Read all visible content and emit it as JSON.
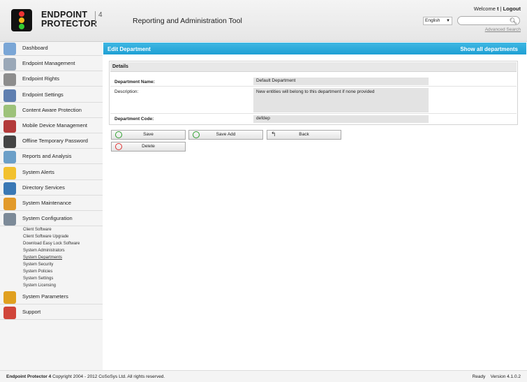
{
  "header": {
    "brand_line1": "ENDPOINT",
    "brand_line2": "PROTECTOR",
    "brand_version": "4",
    "tool_title": "Reporting and Administration Tool",
    "welcome_prefix": "Welcome ",
    "welcome_user": "t",
    "welcome_sep": " | ",
    "logout_label": "Logout",
    "language_value": "English",
    "search_placeholder": "",
    "advanced_search_label": "Advanced Search"
  },
  "sidebar": {
    "items": [
      {
        "label": "Dashboard",
        "icon": "dashboard-icon",
        "color": "#7aa6d6"
      },
      {
        "label": "Endpoint Management",
        "icon": "endpoint-management-icon",
        "color": "#9aa8b8"
      },
      {
        "label": "Endpoint Rights",
        "icon": "endpoint-rights-icon",
        "color": "#8d8d8d"
      },
      {
        "label": "Endpoint Settings",
        "icon": "endpoint-settings-icon",
        "color": "#5f7fb0"
      },
      {
        "label": "Content Aware Protection",
        "icon": "content-aware-icon",
        "color": "#9dc27a"
      },
      {
        "label": "Mobile Device Management",
        "icon": "mobile-device-icon",
        "color": "#b33a3a"
      },
      {
        "label": "Offline Temporary Password",
        "icon": "offline-password-icon",
        "color": "#444444"
      },
      {
        "label": "Reports and Analysis",
        "icon": "reports-icon",
        "color": "#6b9fc8"
      },
      {
        "label": "System Alerts",
        "icon": "alert-icon",
        "color": "#f2c12e"
      },
      {
        "label": "Directory Services",
        "icon": "directory-icon",
        "color": "#3a78b5"
      },
      {
        "label": "System Maintenance",
        "icon": "maintenance-icon",
        "color": "#e29a2b"
      },
      {
        "label": "System Configuration",
        "icon": "configuration-icon",
        "color": "#7c8a98"
      }
    ],
    "sub_items": [
      {
        "label": "Client Software",
        "active": false
      },
      {
        "label": "Client Software Upgrade",
        "active": false
      },
      {
        "label": "Download Easy Lock Software",
        "active": false
      },
      {
        "label": "System Administrators",
        "active": false
      },
      {
        "label": "System Departments",
        "active": true
      },
      {
        "label": "System Security",
        "active": false
      },
      {
        "label": "System Policies",
        "active": false
      },
      {
        "label": "System Settings",
        "active": false
      },
      {
        "label": "System Licensing",
        "active": false
      }
    ],
    "bottom_items": [
      {
        "label": "System Parameters",
        "icon": "parameters-icon",
        "color": "#e0a020"
      },
      {
        "label": "Support",
        "icon": "support-icon",
        "color": "#d0453a"
      }
    ]
  },
  "main": {
    "title": "Edit Department",
    "show_all_label": "Show all departments",
    "panel_title": "Details",
    "fields": {
      "name_label": "Department Name:",
      "name_value": "Default Department",
      "description_label": "Description:",
      "description_value": "New entities will belong to this department if none provided",
      "code_label": "Department Code:",
      "code_value": "defdep"
    },
    "buttons": {
      "save": "Save",
      "save_add": "Save Add",
      "back": "Back",
      "delete": "Delete"
    }
  },
  "footer": {
    "product": "Endpoint Protector 4",
    "copyright": " Copyright 2004 - 2012 CoSoSys Ltd. All rights reserved.",
    "status": "Ready",
    "version": "Version 4.1.0.2"
  },
  "colors": {
    "accent": "#1ea0d4",
    "sidebar_bg": "#f4f4f4"
  }
}
